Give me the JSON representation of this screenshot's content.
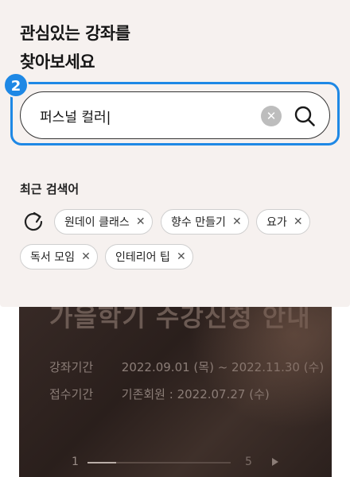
{
  "panel": {
    "headline_line1": "관심있는 강좌를",
    "headline_line2": "찾아보세요"
  },
  "step_badge": "2",
  "search": {
    "value": "퍼스널 컬러|",
    "clear_icon": "close-icon",
    "search_icon": "search-icon",
    "accent_color": "#1e88e5"
  },
  "recent": {
    "label": "최근 검색어",
    "refresh_icon": "refresh-icon",
    "remove_symbol": "✕",
    "chips": [
      {
        "label": "원데이 클래스"
      },
      {
        "label": "향수 만들기"
      },
      {
        "label": "요가"
      },
      {
        "label": "독서 모임"
      },
      {
        "label": "인테리어 팁"
      }
    ]
  },
  "banner": {
    "title": "가을학기 수강신청 안내",
    "period_label": "강좌기간",
    "period_value": "2022.09.01 (목) ~ 2022.11.30 (수)",
    "reg_label": "접수기간",
    "reg_value": "기존회원 : 2022.07.27 (수)",
    "pager_current": "1",
    "pager_total": "5",
    "pager_progress": 0.2
  }
}
